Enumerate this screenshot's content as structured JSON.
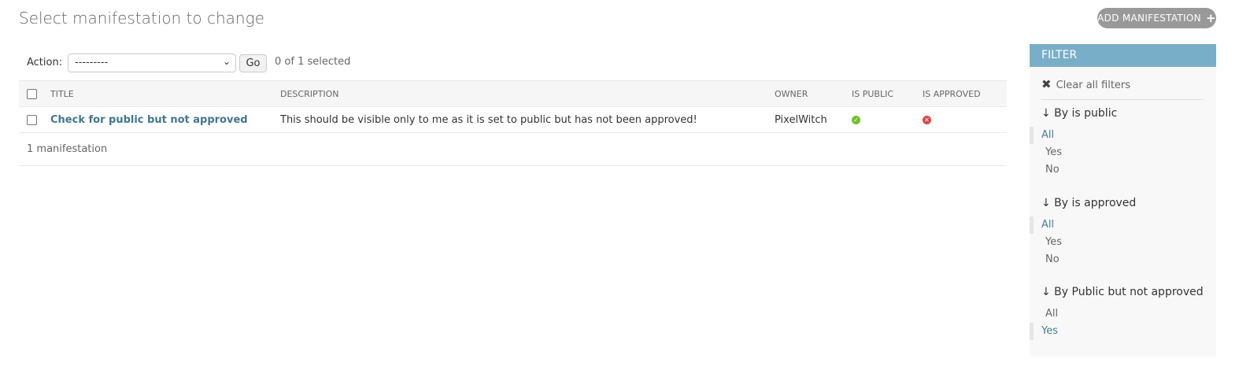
{
  "header": {
    "title": "Select manifestation to change",
    "add_label": "ADD MANIFESTATION"
  },
  "actions": {
    "label": "Action:",
    "selected_option": "---------",
    "go_label": "Go",
    "selection_count": "0 of 1 selected"
  },
  "table": {
    "columns": [
      "TITLE",
      "DESCRIPTION",
      "OWNER",
      "IS PUBLIC",
      "IS APPROVED"
    ],
    "rows": [
      {
        "title": "Check for public but not approved",
        "description": "This should be visible only to me as it is set to public but has not been approved!",
        "owner": "PixelWitch",
        "is_public": true,
        "is_approved": false
      }
    ]
  },
  "paginator": "1 manifestation",
  "filter": {
    "heading": "FILTER",
    "clear_label": "Clear all filters",
    "groups": [
      {
        "title": "↓ By is public",
        "options": [
          "All",
          "Yes",
          "No"
        ],
        "selected": "All"
      },
      {
        "title": "↓ By is approved",
        "options": [
          "All",
          "Yes",
          "No"
        ],
        "selected": "All"
      },
      {
        "title": "↓ By Public but not approved",
        "options": [
          "All",
          "Yes"
        ],
        "selected": "Yes"
      }
    ]
  },
  "colors": {
    "filter_header": "#79aec8",
    "link": "#417690",
    "yes": "#70bf2b",
    "no": "#dd4646"
  }
}
